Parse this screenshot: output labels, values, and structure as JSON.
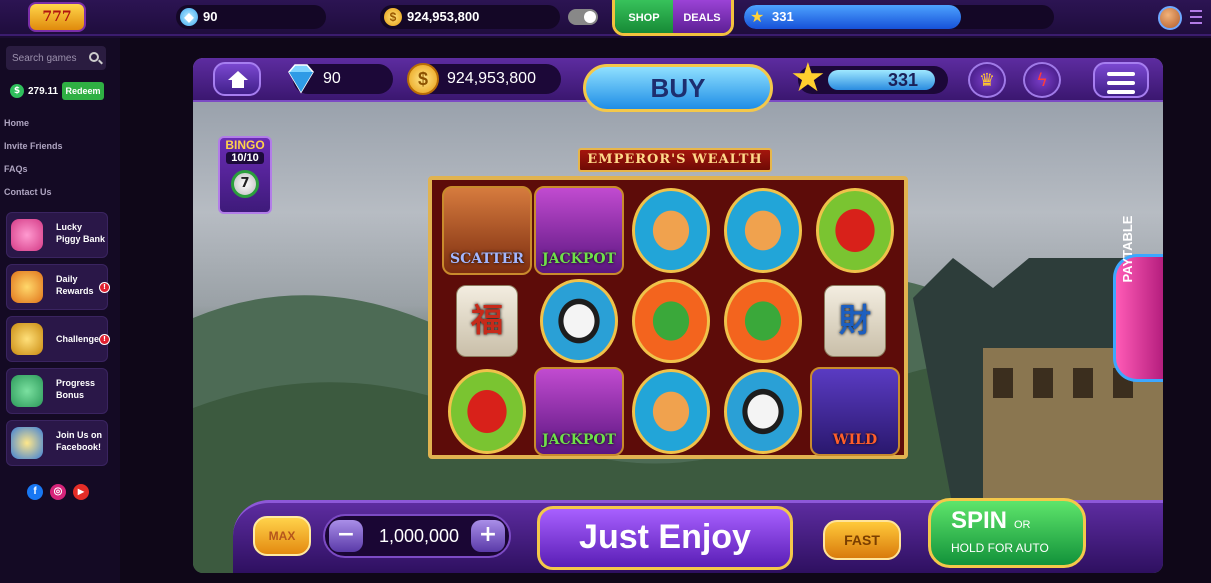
{
  "topbar": {
    "logo_text": "777",
    "gems": "90",
    "coins": "924,953,800",
    "shop_label": "SHOP",
    "deals_label": "DEALS",
    "xp_value": "331",
    "xp_fill_fraction": 0.7
  },
  "sidebar": {
    "search_placeholder": "Search games",
    "balance": "279.11",
    "balance_icon": "$",
    "redeem_label": "Redeem",
    "links": [
      "Home",
      "Invite Friends",
      "FAQs",
      "Contact Us"
    ],
    "promos": [
      {
        "label": "Lucky Piggy Bank",
        "icon": "piggy-bank-icon",
        "badge": ""
      },
      {
        "label": "Daily Rewards",
        "icon": "gift-icon",
        "badge": "!"
      },
      {
        "label": "Challenges",
        "icon": "trophy-icon",
        "badge": "!"
      },
      {
        "label": "Progress Bonus",
        "icon": "map-icon",
        "badge": ""
      },
      {
        "label": "Join Us on Facebook!",
        "icon": "coins-icon",
        "badge": ""
      }
    ],
    "social": {
      "facebook": "f",
      "instagram": "◎",
      "youtube": "▶"
    }
  },
  "game": {
    "gems": "90",
    "coins": "924,953,800",
    "buy_label": "BUY",
    "level": "331",
    "level_fill_fraction": 0.92,
    "title": "EMPEROR'S WEALTH",
    "bingo": {
      "title": "BINGO",
      "count": "10/10",
      "ball": "7"
    },
    "paytable_label": "PAYTABLE",
    "reels": [
      [
        {
          "type": "scatter",
          "caption": "SCATTER"
        },
        {
          "type": "jackpot",
          "caption": "JACKPOT"
        },
        {
          "type": "tiger",
          "caption": ""
        },
        {
          "type": "tiger",
          "caption": ""
        },
        {
          "type": "envelope",
          "caption": ""
        }
      ],
      [
        {
          "type": "tile",
          "caption": "福"
        },
        {
          "type": "panda",
          "caption": ""
        },
        {
          "type": "dragon",
          "caption": ""
        },
        {
          "type": "dragon",
          "caption": ""
        },
        {
          "type": "tile-blue",
          "caption": "財"
        }
      ],
      [
        {
          "type": "envelope",
          "caption": ""
        },
        {
          "type": "jackpot",
          "caption": "JACKPOT"
        },
        {
          "type": "tiger",
          "caption": ""
        },
        {
          "type": "panda",
          "caption": ""
        },
        {
          "type": "wild",
          "caption": "WILD"
        }
      ]
    ],
    "controls": {
      "max_label": "MAX",
      "minus_label": "−",
      "bet": "1,000,000",
      "plus_label": "+",
      "enjoy_label": "Just Enjoy",
      "fast_label": "FAST",
      "spin_label": "SPIN",
      "spin_or": "OR",
      "spin_hint": "HOLD FOR AUTO"
    }
  },
  "colors": {
    "accent": "#5d2ca0",
    "gold": "#f4c84a",
    "spin": "#12923a"
  }
}
